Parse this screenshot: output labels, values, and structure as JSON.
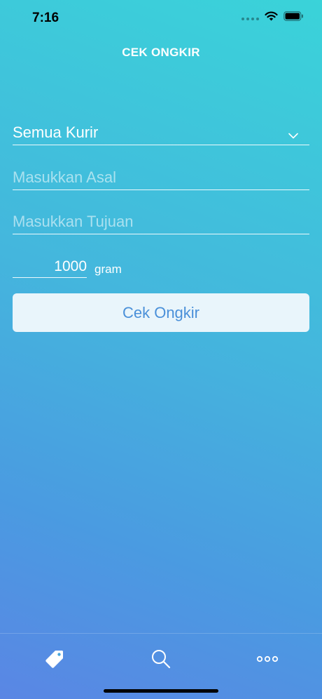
{
  "status_bar": {
    "time": "7:16"
  },
  "nav": {
    "title": "CEK ONGKIR"
  },
  "form": {
    "courier_value": "Semua Kurir",
    "origin_placeholder": "Masukkan Asal",
    "destination_placeholder": "Masukkan Tujuan",
    "weight_value": "1000",
    "weight_unit": "gram",
    "submit_label": "Cek Ongkir"
  },
  "tab_bar": {
    "items": [
      {
        "icon": "tag-icon"
      },
      {
        "icon": "search-icon"
      },
      {
        "icon": "more-icon"
      }
    ]
  },
  "colors": {
    "accent": "#4a90d9",
    "button_bg": "#e9f5fb"
  }
}
